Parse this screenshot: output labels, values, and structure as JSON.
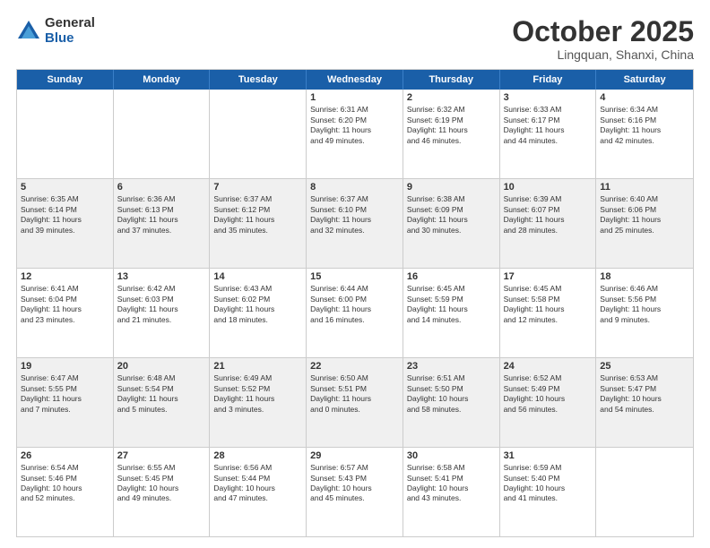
{
  "logo": {
    "general": "General",
    "blue": "Blue"
  },
  "title": "October 2025",
  "subtitle": "Lingquan, Shanxi, China",
  "days": [
    "Sunday",
    "Monday",
    "Tuesday",
    "Wednesday",
    "Thursday",
    "Friday",
    "Saturday"
  ],
  "rows": [
    [
      {
        "day": "",
        "lines": []
      },
      {
        "day": "",
        "lines": []
      },
      {
        "day": "",
        "lines": []
      },
      {
        "day": "1",
        "lines": [
          "Sunrise: 6:31 AM",
          "Sunset: 6:20 PM",
          "Daylight: 11 hours",
          "and 49 minutes."
        ]
      },
      {
        "day": "2",
        "lines": [
          "Sunrise: 6:32 AM",
          "Sunset: 6:19 PM",
          "Daylight: 11 hours",
          "and 46 minutes."
        ]
      },
      {
        "day": "3",
        "lines": [
          "Sunrise: 6:33 AM",
          "Sunset: 6:17 PM",
          "Daylight: 11 hours",
          "and 44 minutes."
        ]
      },
      {
        "day": "4",
        "lines": [
          "Sunrise: 6:34 AM",
          "Sunset: 6:16 PM",
          "Daylight: 11 hours",
          "and 42 minutes."
        ]
      }
    ],
    [
      {
        "day": "5",
        "lines": [
          "Sunrise: 6:35 AM",
          "Sunset: 6:14 PM",
          "Daylight: 11 hours",
          "and 39 minutes."
        ]
      },
      {
        "day": "6",
        "lines": [
          "Sunrise: 6:36 AM",
          "Sunset: 6:13 PM",
          "Daylight: 11 hours",
          "and 37 minutes."
        ]
      },
      {
        "day": "7",
        "lines": [
          "Sunrise: 6:37 AM",
          "Sunset: 6:12 PM",
          "Daylight: 11 hours",
          "and 35 minutes."
        ]
      },
      {
        "day": "8",
        "lines": [
          "Sunrise: 6:37 AM",
          "Sunset: 6:10 PM",
          "Daylight: 11 hours",
          "and 32 minutes."
        ]
      },
      {
        "day": "9",
        "lines": [
          "Sunrise: 6:38 AM",
          "Sunset: 6:09 PM",
          "Daylight: 11 hours",
          "and 30 minutes."
        ]
      },
      {
        "day": "10",
        "lines": [
          "Sunrise: 6:39 AM",
          "Sunset: 6:07 PM",
          "Daylight: 11 hours",
          "and 28 minutes."
        ]
      },
      {
        "day": "11",
        "lines": [
          "Sunrise: 6:40 AM",
          "Sunset: 6:06 PM",
          "Daylight: 11 hours",
          "and 25 minutes."
        ]
      }
    ],
    [
      {
        "day": "12",
        "lines": [
          "Sunrise: 6:41 AM",
          "Sunset: 6:04 PM",
          "Daylight: 11 hours",
          "and 23 minutes."
        ]
      },
      {
        "day": "13",
        "lines": [
          "Sunrise: 6:42 AM",
          "Sunset: 6:03 PM",
          "Daylight: 11 hours",
          "and 21 minutes."
        ]
      },
      {
        "day": "14",
        "lines": [
          "Sunrise: 6:43 AM",
          "Sunset: 6:02 PM",
          "Daylight: 11 hours",
          "and 18 minutes."
        ]
      },
      {
        "day": "15",
        "lines": [
          "Sunrise: 6:44 AM",
          "Sunset: 6:00 PM",
          "Daylight: 11 hours",
          "and 16 minutes."
        ]
      },
      {
        "day": "16",
        "lines": [
          "Sunrise: 6:45 AM",
          "Sunset: 5:59 PM",
          "Daylight: 11 hours",
          "and 14 minutes."
        ]
      },
      {
        "day": "17",
        "lines": [
          "Sunrise: 6:45 AM",
          "Sunset: 5:58 PM",
          "Daylight: 11 hours",
          "and 12 minutes."
        ]
      },
      {
        "day": "18",
        "lines": [
          "Sunrise: 6:46 AM",
          "Sunset: 5:56 PM",
          "Daylight: 11 hours",
          "and 9 minutes."
        ]
      }
    ],
    [
      {
        "day": "19",
        "lines": [
          "Sunrise: 6:47 AM",
          "Sunset: 5:55 PM",
          "Daylight: 11 hours",
          "and 7 minutes."
        ]
      },
      {
        "day": "20",
        "lines": [
          "Sunrise: 6:48 AM",
          "Sunset: 5:54 PM",
          "Daylight: 11 hours",
          "and 5 minutes."
        ]
      },
      {
        "day": "21",
        "lines": [
          "Sunrise: 6:49 AM",
          "Sunset: 5:52 PM",
          "Daylight: 11 hours",
          "and 3 minutes."
        ]
      },
      {
        "day": "22",
        "lines": [
          "Sunrise: 6:50 AM",
          "Sunset: 5:51 PM",
          "Daylight: 11 hours",
          "and 0 minutes."
        ]
      },
      {
        "day": "23",
        "lines": [
          "Sunrise: 6:51 AM",
          "Sunset: 5:50 PM",
          "Daylight: 10 hours",
          "and 58 minutes."
        ]
      },
      {
        "day": "24",
        "lines": [
          "Sunrise: 6:52 AM",
          "Sunset: 5:49 PM",
          "Daylight: 10 hours",
          "and 56 minutes."
        ]
      },
      {
        "day": "25",
        "lines": [
          "Sunrise: 6:53 AM",
          "Sunset: 5:47 PM",
          "Daylight: 10 hours",
          "and 54 minutes."
        ]
      }
    ],
    [
      {
        "day": "26",
        "lines": [
          "Sunrise: 6:54 AM",
          "Sunset: 5:46 PM",
          "Daylight: 10 hours",
          "and 52 minutes."
        ]
      },
      {
        "day": "27",
        "lines": [
          "Sunrise: 6:55 AM",
          "Sunset: 5:45 PM",
          "Daylight: 10 hours",
          "and 49 minutes."
        ]
      },
      {
        "day": "28",
        "lines": [
          "Sunrise: 6:56 AM",
          "Sunset: 5:44 PM",
          "Daylight: 10 hours",
          "and 47 minutes."
        ]
      },
      {
        "day": "29",
        "lines": [
          "Sunrise: 6:57 AM",
          "Sunset: 5:43 PM",
          "Daylight: 10 hours",
          "and 45 minutes."
        ]
      },
      {
        "day": "30",
        "lines": [
          "Sunrise: 6:58 AM",
          "Sunset: 5:41 PM",
          "Daylight: 10 hours",
          "and 43 minutes."
        ]
      },
      {
        "day": "31",
        "lines": [
          "Sunrise: 6:59 AM",
          "Sunset: 5:40 PM",
          "Daylight: 10 hours",
          "and 41 minutes."
        ]
      },
      {
        "day": "",
        "lines": []
      }
    ]
  ]
}
